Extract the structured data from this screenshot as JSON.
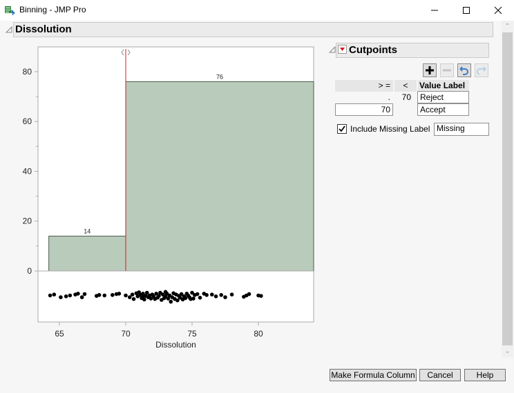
{
  "window": {
    "title": "Binning - JMP Pro",
    "controls": {
      "minimize": "minimize",
      "maximize": "maximize",
      "close": "close"
    }
  },
  "section": {
    "title": "Dissolution"
  },
  "chart_data": {
    "type": "bar",
    "title": "",
    "xlabel": "Dissolution",
    "ylabel": "",
    "bins": [
      {
        "from": 64.2,
        "to": 70,
        "count": 14,
        "label": "14"
      },
      {
        "from": 70,
        "to": 84.2,
        "count": 76,
        "label": "76"
      }
    ],
    "categories": [
      "< 70",
      ">= 70"
    ],
    "values": [
      14,
      76
    ],
    "xlim": [
      63.5,
      84.5
    ],
    "ylim": [
      0,
      90
    ],
    "x_ticks": [
      65,
      70,
      75,
      80
    ],
    "x_tick_labels": [
      "65",
      "70",
      "75",
      "80"
    ],
    "y_ticks": [
      0,
      20,
      40,
      60,
      80
    ],
    "y_tick_labels": [
      "0",
      "20",
      "40",
      "60",
      "80"
    ],
    "y_minor_ticks": [
      10,
      30,
      50,
      70
    ],
    "cutpoint": 70,
    "grid": false,
    "points": [
      64.3,
      64.6,
      65.1,
      65.5,
      65.8,
      66.2,
      66.4,
      66.7,
      66.9,
      67.8,
      68.0,
      68.4,
      69.0,
      69.3,
      69.5,
      70.0,
      70.3,
      70.5,
      70.6,
      70.8,
      70.9,
      71.0,
      71.1,
      71.2,
      71.3,
      71.3,
      71.4,
      71.5,
      71.6,
      71.7,
      71.8,
      71.9,
      72.0,
      72.1,
      72.2,
      72.3,
      72.4,
      72.5,
      72.6,
      72.7,
      72.8,
      72.9,
      73.0,
      73.0,
      73.1,
      73.2,
      73.3,
      73.4,
      73.5,
      73.6,
      73.7,
      73.8,
      73.9,
      74.0,
      74.1,
      74.2,
      74.3,
      74.4,
      74.5,
      74.6,
      74.7,
      74.8,
      74.9,
      75.0,
      75.1,
      75.2,
      75.4,
      75.6,
      75.9,
      76.1,
      76.5,
      76.8,
      77.2,
      77.5,
      78.0,
      78.9,
      79.1,
      79.3,
      80.0,
      80.2
    ],
    "point_jitter": [
      0.5,
      0.4,
      0.7,
      0.6,
      0.5,
      0.4,
      0.3,
      0.7,
      0.35,
      0.55,
      0.45,
      0.5,
      0.45,
      0.35,
      0.3,
      0.5,
      0.7,
      0.4,
      0.9,
      0.25,
      0.6,
      0.15,
      0.45,
      0.8,
      0.3,
      0.6,
      0.95,
      0.55,
      0.2,
      0.7,
      0.5,
      0.85,
      0.4,
      0.6,
      0.9,
      0.3,
      0.75,
      0.55,
      0.2,
      1.0,
      0.4,
      0.8,
      0.1,
      0.6,
      0.3,
      0.85,
      0.5,
      1.2,
      0.7,
      0.25,
      0.9,
      0.4,
      1.05,
      0.55,
      0.75,
      0.35,
      0.95,
      0.6,
      0.8,
      0.3,
      0.5,
      0.7,
      0.9,
      0.2,
      0.85,
      0.45,
      0.35,
      0.75,
      0.3,
      0.45,
      0.4,
      0.6,
      0.45,
      0.7,
      0.4,
      0.65,
      0.5,
      0.35,
      0.5,
      0.55
    ]
  },
  "cutpoints": {
    "title": "Cutpoints",
    "toolbar": {
      "add": "add-cutpoint",
      "remove": "remove-cutpoint",
      "undo": "undo",
      "redo": "redo"
    },
    "columns": {
      "ge": "> =",
      "lt": "<",
      "value_label": "Value Label"
    },
    "rows": [
      {
        "ge": ".",
        "lt": "70",
        "label": "Reject"
      },
      {
        "ge": "70",
        "lt": "",
        "label": "Accept"
      }
    ],
    "include_missing": {
      "label": "Include Missing Label",
      "checked": true,
      "value": "Missing"
    }
  },
  "buttons": {
    "make_formula": "Make Formula Column",
    "cancel": "Cancel",
    "help": "Help"
  },
  "colors": {
    "bar_fill": "#b9cbbb",
    "bar_stroke": "#4a5a4c",
    "cutpoint_line": "#e0141e",
    "header_bg": "#ebebeb",
    "dropdown_red": "#d8141b"
  }
}
